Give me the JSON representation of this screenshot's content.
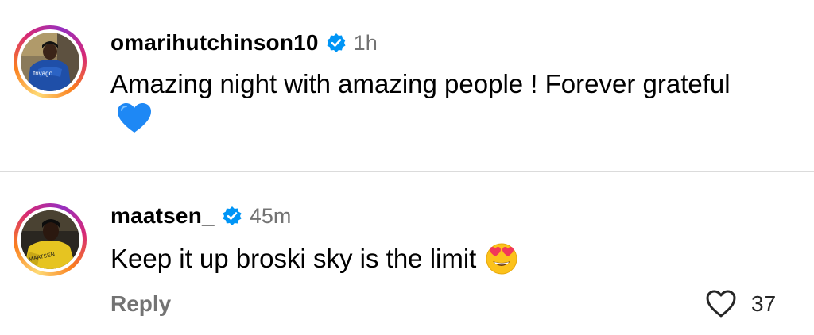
{
  "comments": [
    {
      "username": "omarihutchinson10",
      "verified": true,
      "time": "1h",
      "text": "Amazing night with amazing people ! Forever grateful",
      "emoji": "blue-heart-emoji",
      "avatar_jersey_text": "trivago"
    },
    {
      "username": "maatsen_",
      "verified": true,
      "time": "45m",
      "text": "Keep it up broski sky is the limit",
      "emoji": "heart-eyes-emoji",
      "avatar_jersey_text": "MAATSEN",
      "reply_label": "Reply",
      "like_count": "37"
    }
  ],
  "colors": {
    "verified_blue": "#0095f6",
    "muted_text": "#737373",
    "divider": "#dbdbdb"
  }
}
